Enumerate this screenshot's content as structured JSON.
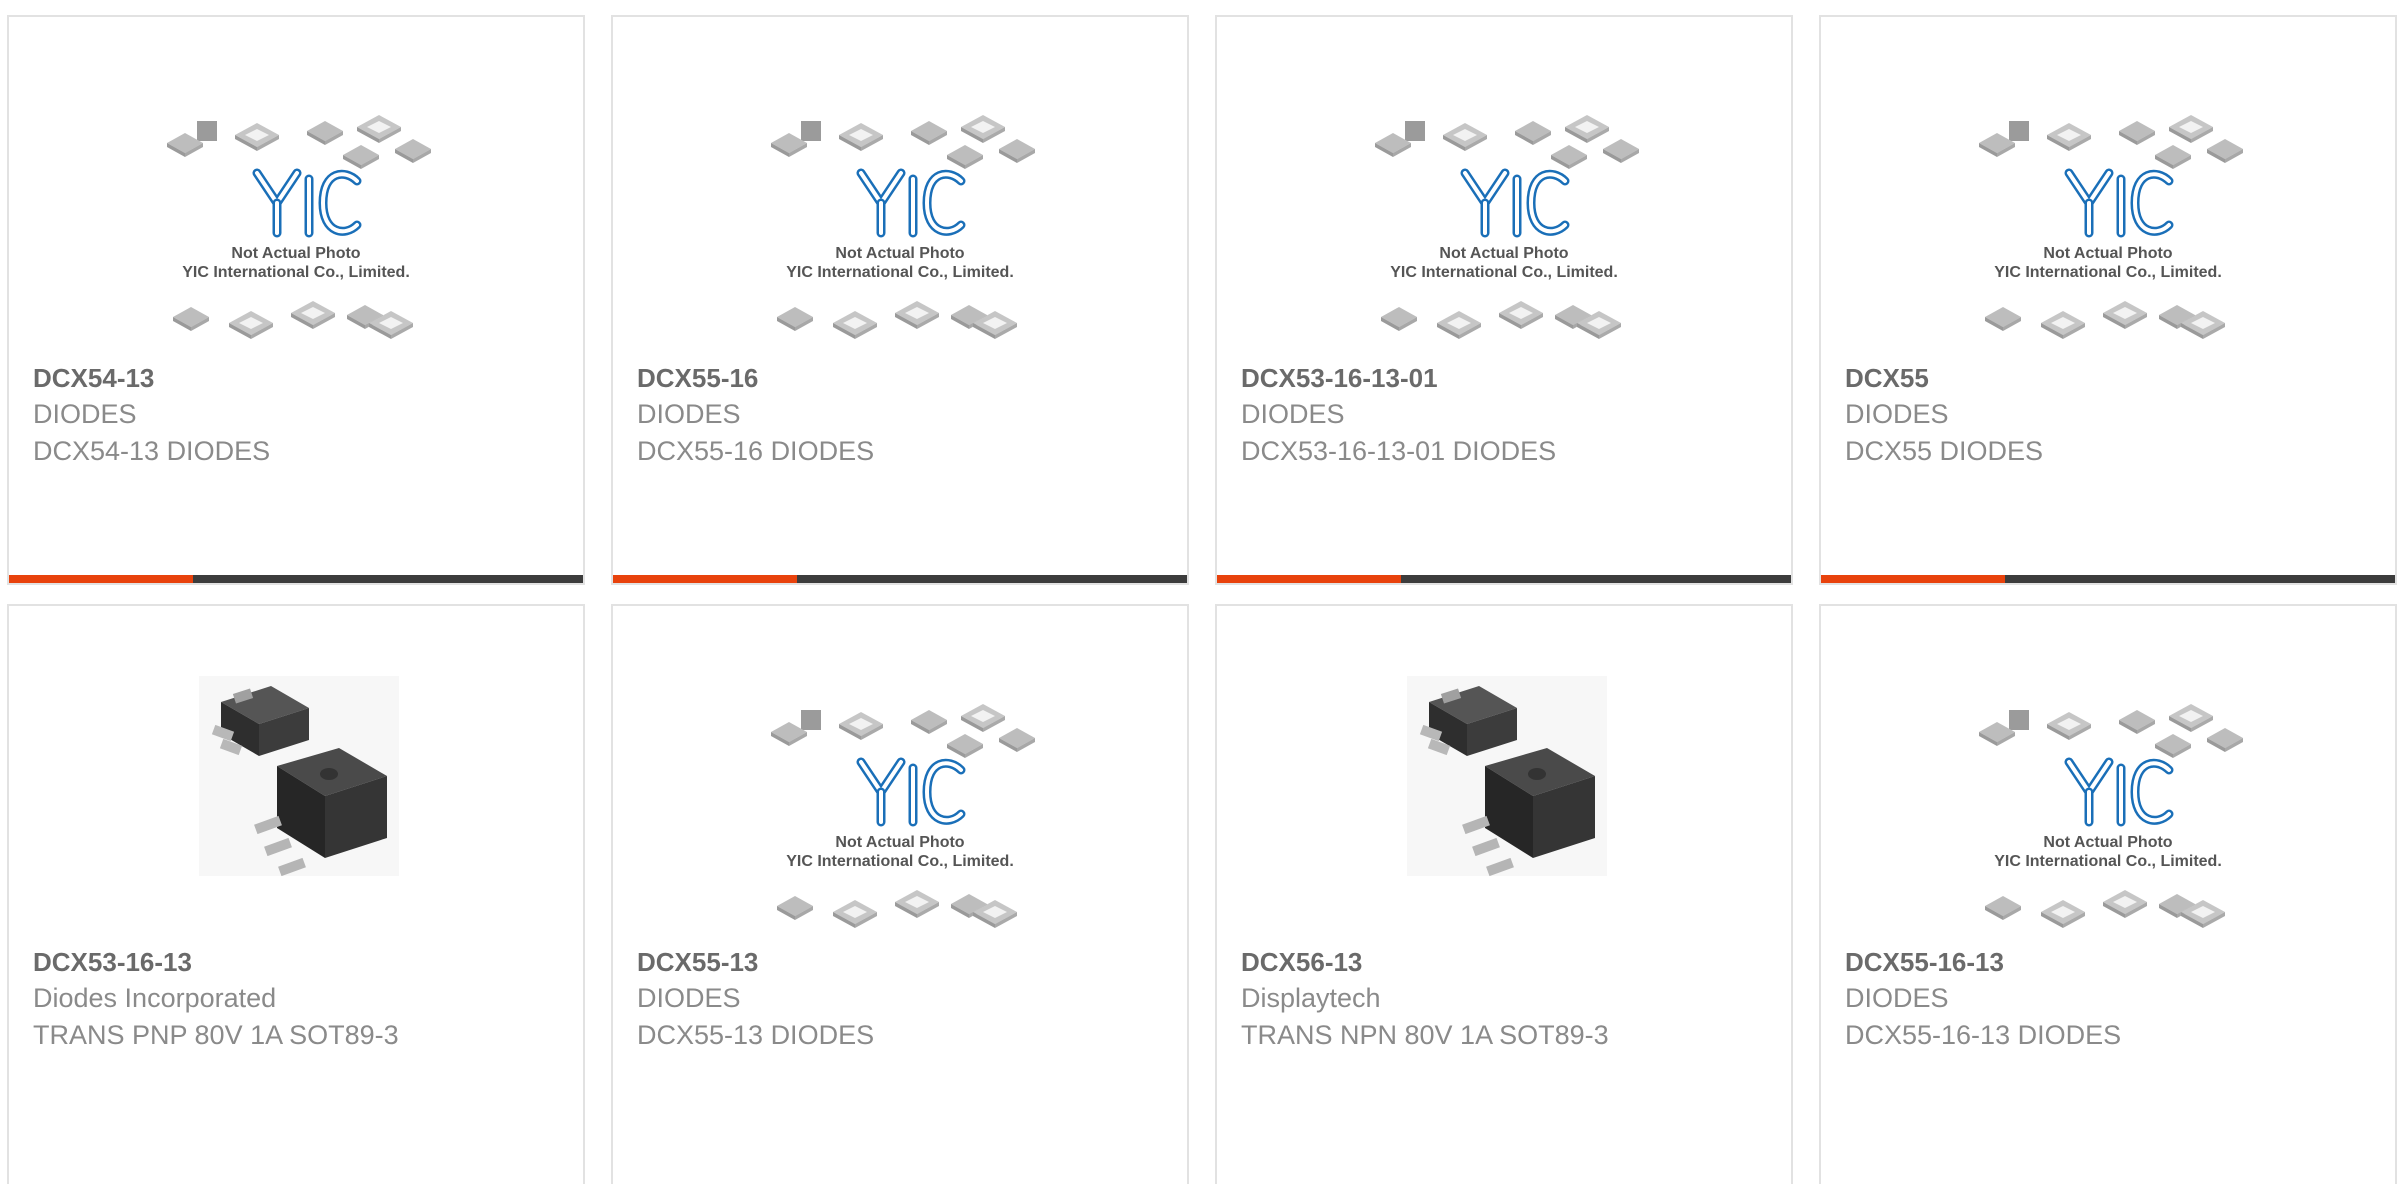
{
  "placeholder": {
    "brand": "YIC",
    "line1": "Not Actual Photo",
    "line2": "YIC International Co., Limited."
  },
  "products": [
    {
      "part": "DCX54-13",
      "manufacturer": "DIODES",
      "description": "DCX54-13 DIODES",
      "image": "placeholder-logo"
    },
    {
      "part": "DCX55-16",
      "manufacturer": "DIODES",
      "description": "DCX55-16 DIODES",
      "image": "placeholder-logo"
    },
    {
      "part": "DCX53-16-13-01",
      "manufacturer": "DIODES",
      "description": "DCX53-16-13-01 DIODES",
      "image": "placeholder-logo"
    },
    {
      "part": "DCX55",
      "manufacturer": "DIODES",
      "description": "DCX55 DIODES",
      "image": "placeholder-logo"
    },
    {
      "part": "DCX53-16-13",
      "manufacturer": "Diodes Incorporated",
      "description": "TRANS PNP 80V 1A SOT89-3",
      "image": "sot89-package"
    },
    {
      "part": "DCX55-13",
      "manufacturer": "DIODES",
      "description": "DCX55-13 DIODES",
      "image": "placeholder-logo"
    },
    {
      "part": "DCX56-13",
      "manufacturer": "Displaytech",
      "description": "TRANS NPN 80V 1A SOT89-3",
      "image": "sot89-package"
    },
    {
      "part": "DCX55-16-13",
      "manufacturer": "DIODES",
      "description": "DCX55-16-13 DIODES",
      "image": "placeholder-logo"
    }
  ],
  "colors": {
    "accent": "#e8420c",
    "bar": "#3c3c3c",
    "logo": "#1a6fb8"
  }
}
